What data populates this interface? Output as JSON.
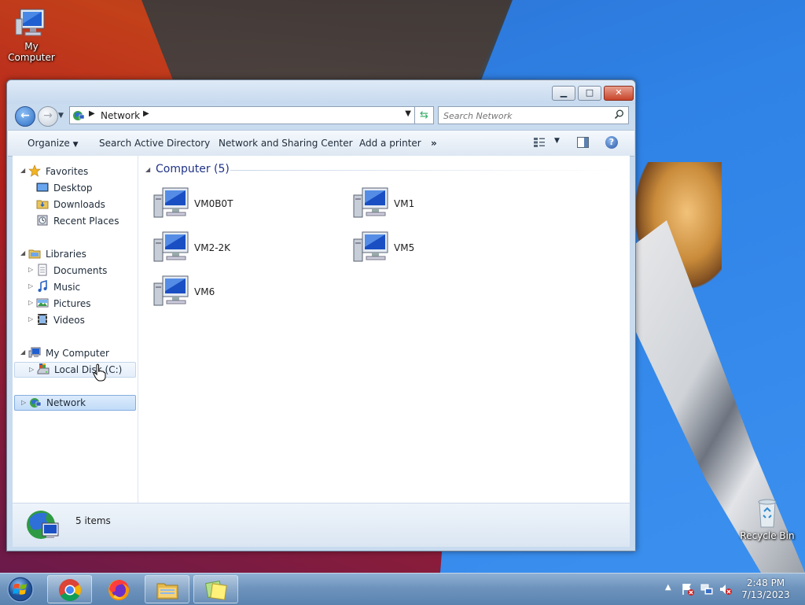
{
  "desktop": {
    "icons": [
      {
        "label": "My Computer",
        "icon": "computer-icon"
      },
      {
        "label": "Recycle Bin",
        "icon": "recycle-bin-icon"
      }
    ]
  },
  "window": {
    "address": {
      "location": "Network"
    },
    "search": {
      "placeholder": "Search Network"
    },
    "toolbar": {
      "organize": "Organize",
      "search_ad": "Search Active Directory",
      "sharing_center": "Network and Sharing Center",
      "add_printer": "Add a printer",
      "more": "»"
    },
    "nav": {
      "favorites": "Favorites",
      "desktop": "Desktop",
      "downloads": "Downloads",
      "recent_places": "Recent Places",
      "libraries": "Libraries",
      "documents": "Documents",
      "music": "Music",
      "pictures": "Pictures",
      "videos": "Videos",
      "my_computer": "My Computer",
      "local_disk": "Local Disk (C:)",
      "network": "Network"
    },
    "group": {
      "header": "Computer (5)"
    },
    "computers": [
      "VM0B0T",
      "VM1",
      "VM2-2K",
      "VM5",
      "VM6"
    ],
    "details": {
      "count": "5 items"
    }
  },
  "taskbar": {
    "apps": [
      "chrome-icon",
      "firefox-icon",
      "explorer-icon",
      "notes-icon"
    ],
    "clock": {
      "time": "2:48 PM",
      "date": "7/13/2023"
    }
  },
  "colors": {
    "accent": "#1e3287",
    "selection": "#c1dbf7",
    "taskbar": "#6e94bd"
  }
}
